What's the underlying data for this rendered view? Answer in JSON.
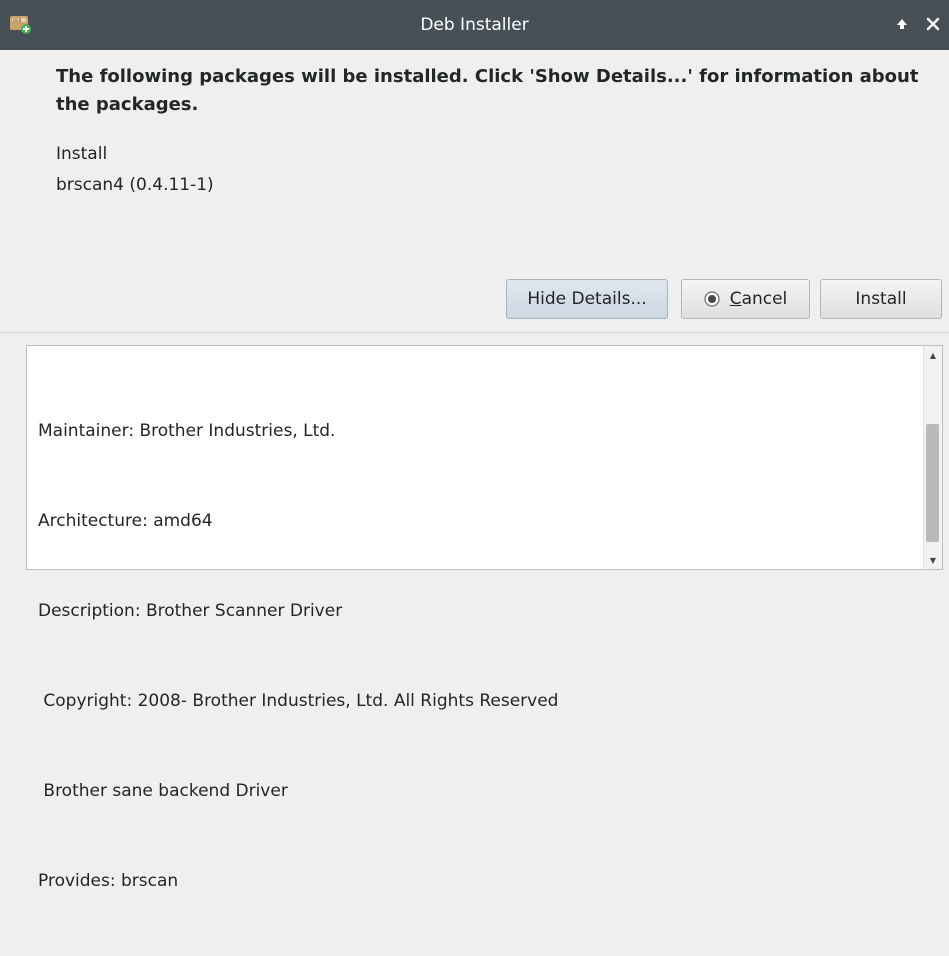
{
  "window": {
    "title": "Deb Installer",
    "icons": {
      "app": "deb-package-icon",
      "keep_above": "arrow-up-icon",
      "close": "close-icon"
    }
  },
  "message": "The following packages will be installed. Click 'Show Details...' for information about the packages.",
  "packages": {
    "action": "Install",
    "items": [
      "brscan4 (0.4.11-1)"
    ]
  },
  "buttons": {
    "hide_details": "Hide Details...",
    "cancel": "Cancel",
    "install": "Install"
  },
  "details": {
    "lines": [
      "Maintainer: Brother Industries, Ltd.",
      "Architecture: amd64",
      "Description: Brother Scanner Driver",
      " Copyright: 2008- Brother Industries, Ltd. All Rights Reserved",
      " Brother sane backend Driver",
      "Provides: brscan"
    ]
  },
  "colors": {
    "titlebar": "#475057",
    "window_bg": "#efefef",
    "hide_details_bg": "#d6dee8"
  }
}
